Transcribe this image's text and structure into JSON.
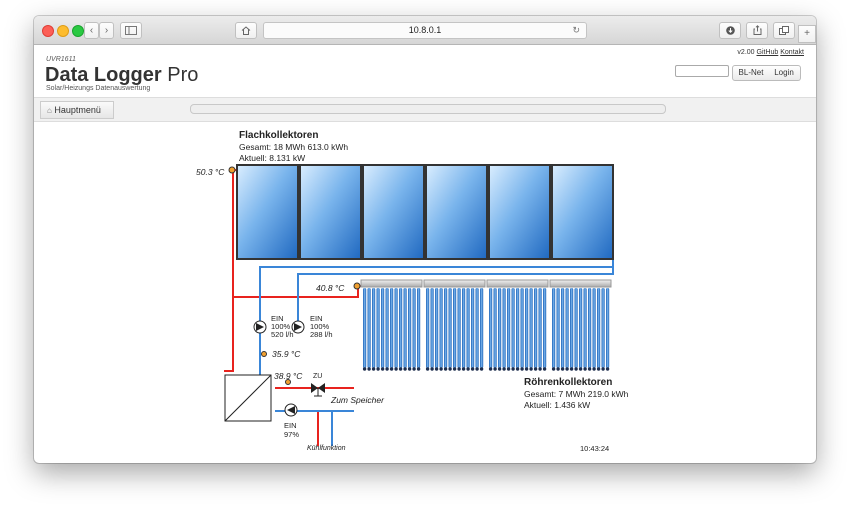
{
  "browser": {
    "url": "10.8.0.1"
  },
  "app": {
    "model": "UVR1611",
    "title_bold": "Data Logger",
    "title_light": "Pro",
    "subtitle": "Solar/Heizungs Datenauswertung",
    "version": "v2.00",
    "link_github": "GitHub",
    "link_contact": "Kontakt",
    "btn_blnet": "BL-Net",
    "btn_login": "Login"
  },
  "nav": {
    "menu_label": "Hauptmenü",
    "progress_fraction": 0.0
  },
  "diagram": {
    "flat": {
      "title": "Flachkollektoren",
      "total": "Gesamt: 18 MWh 613.0 kWh",
      "current": "Aktuell: 8.131 kW",
      "temp": "50.3 °C"
    },
    "tube": {
      "title": "Röhrenkollektoren",
      "total": "Gesamt: 7 MWh 219.0 kWh",
      "current": "Aktuell: 1.436 kW",
      "temp": "40.8 °C"
    },
    "pump1": {
      "state": "EIN",
      "percent": "100%",
      "flow": "520 l/h"
    },
    "pump2": {
      "state": "EIN",
      "percent": "100%",
      "flow": "288 l/h"
    },
    "pump3": {
      "state": "EIN",
      "percent": "97%"
    },
    "temp_return": "35.9 °C",
    "temp_hx": "38.9 °C",
    "valve_state": "ZU",
    "to_storage": "Zum Speicher",
    "cooling": "Kühlfunktion",
    "time": "10:43:24"
  },
  "icons": {
    "home": "home-icon",
    "download": "download-icon",
    "share": "share-icon",
    "tabs": "tabs-icon",
    "reload": "reload-icon"
  },
  "colors": {
    "hot": "#e8231e",
    "cold": "#3a86d8",
    "panel": "#2f7fd0"
  }
}
